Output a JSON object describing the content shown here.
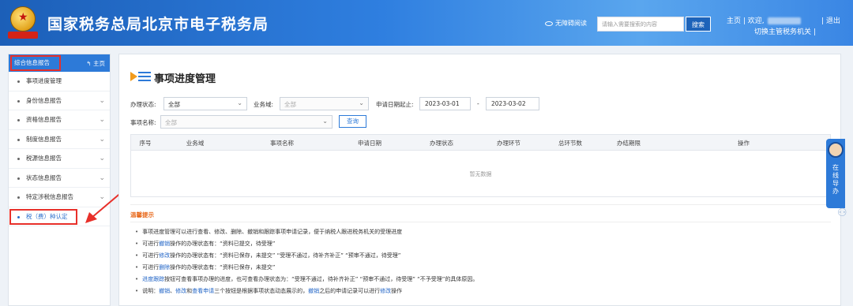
{
  "header": {
    "title": "国家税务总局北京市电子税务局",
    "emblem_text": "中国税务",
    "accessibility": "无障碍阅读",
    "search_placeholder": "请输入需要搜索的内容",
    "search_button": "搜索",
    "home": "主页",
    "welcome": "欢迎,",
    "switch_office": "切换主管税务机关",
    "logout": "退出"
  },
  "sidebar": {
    "title": "综合信息报告",
    "home": "主页",
    "items": [
      {
        "label": "事项进度管理"
      },
      {
        "label": "身份信息报告"
      },
      {
        "label": "资格信息报告"
      },
      {
        "label": "制度信息报告"
      },
      {
        "label": "税源信息报告"
      },
      {
        "label": "状态信息报告"
      },
      {
        "label": "特定涉税信息报告"
      },
      {
        "label": "税（费）种认定"
      }
    ]
  },
  "main": {
    "page_title": "事项进度管理",
    "filters": {
      "status_label": "办理状态:",
      "status_value": "全部",
      "domain_label": "业务域:",
      "domain_value": "全部",
      "date_label": "申请日期起止:",
      "date_start": "2023-03-01",
      "date_sep": "-",
      "date_end": "2023-03-02",
      "name_label": "事项名称:",
      "name_value": "全部",
      "query": "查询"
    },
    "table": {
      "columns": [
        "序号",
        "业务域",
        "事项名称",
        "申请日期",
        "办理状态",
        "办理环节",
        "总环节数",
        "办结期限",
        "操作"
      ],
      "empty": "暂无数据"
    },
    "tips": {
      "title": "温馨提示",
      "lines": [
        {
          "pre": "事项进度管理可以进行查看、修改、删除、撤销和跟踪事项申请记录，便于纳税人跟进税务机关的受理进度",
          "hl": "",
          "post": ""
        },
        {
          "pre": "可进行",
          "hl": "撤销",
          "post": "操作的办理状态有：“资料已提交，待受理”"
        },
        {
          "pre": "可进行",
          "hl": "修改",
          "post": "操作的办理状态有：“资料已保存，未提交” “受理不通过，待补齐补正” “预审不通过，待受理”"
        },
        {
          "pre": "可进行",
          "hl": "删除",
          "post": "操作的办理状态有：“资料已保存，未提交”"
        },
        {
          "pre": "",
          "hl": "进度跟踪",
          "post": "按钮可查看事项办理的进度，也可查看办理状态为：“受理不通过，待补齐补正” “预审不通过，待受理” “不予受理”的具体原因。"
        }
      ],
      "last": {
        "p1": "说明：",
        "h1": "撤销",
        "p2": "、",
        "h2": "修改",
        "p3": "和",
        "h3": "查看申请",
        "p4": "三个按钮是根据事项状态动态展示的，",
        "h4": "撤销",
        "p5": "之后的申请记录可以进行",
        "h5": "修改",
        "p6": "操作"
      }
    }
  },
  "assistant": {
    "label": "在线导办"
  },
  "colors": {
    "header": "#2f7fe0",
    "accent": "#2d7ad8",
    "highlight_box": "#e8302a",
    "tip_title": "#e8681a"
  }
}
